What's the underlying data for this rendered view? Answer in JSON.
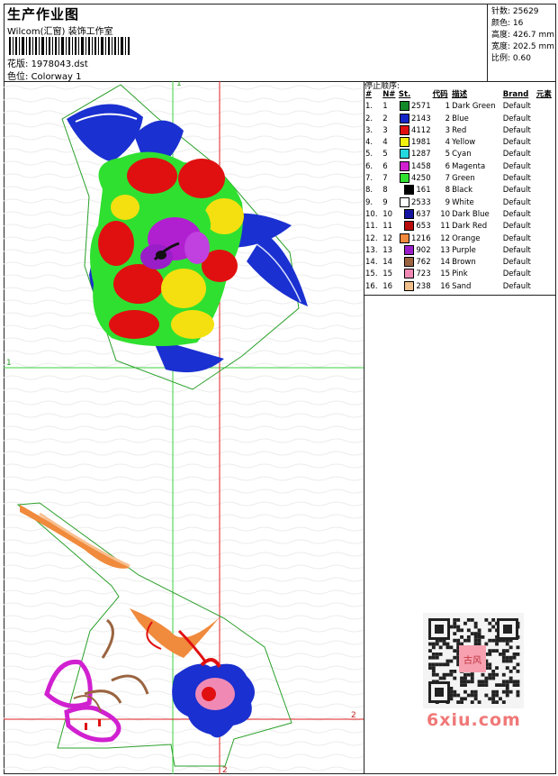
{
  "header": {
    "title": "生产作业图",
    "studio": "Wilcom(汇窗)  装饰工作室",
    "design_label": "花版:",
    "design_value": "1978043.dst",
    "colorway_label": "色位:",
    "colorway_value": "Colorway 1"
  },
  "stats": {
    "stitches": "针数: 25629",
    "colors": "颜色: 16",
    "height": "高度: 426.7 mm",
    "width": "宽度: 202.5 mm",
    "scale": "比例: 0.60"
  },
  "stop_sequence": {
    "title": "停止顺序:",
    "headers": [
      "#",
      "N#",
      "St.",
      "代码",
      "描述",
      "Brand",
      "元素"
    ],
    "rows": [
      {
        "n": "1.",
        "id": "1",
        "color": "#138a2a",
        "st": "2571",
        "code": "1",
        "desc": "Dark Green",
        "brand": "Default"
      },
      {
        "n": "2.",
        "id": "2",
        "color": "#1426c8",
        "st": "2143",
        "code": "2",
        "desc": "Blue",
        "brand": "Default"
      },
      {
        "n": "3.",
        "id": "3",
        "color": "#e01010",
        "st": "4112",
        "code": "3",
        "desc": "Red",
        "brand": "Default"
      },
      {
        "n": "4.",
        "id": "4",
        "color": "#f4f010",
        "st": "1981",
        "code": "4",
        "desc": "Yellow",
        "brand": "Default"
      },
      {
        "n": "5.",
        "id": "5",
        "color": "#24d8e0",
        "st": "1287",
        "code": "5",
        "desc": "Cyan",
        "brand": "Default"
      },
      {
        "n": "6.",
        "id": "6",
        "color": "#d020d0",
        "st": "1458",
        "code": "6",
        "desc": "Magenta",
        "brand": "Default"
      },
      {
        "n": "7.",
        "id": "7",
        "color": "#30e030",
        "st": "4250",
        "code": "7",
        "desc": "Green",
        "brand": "Default"
      },
      {
        "n": "8.",
        "id": "8",
        "color": "#000000",
        "st": "161",
        "code": "8",
        "desc": "Black",
        "brand": "Default"
      },
      {
        "n": "9.",
        "id": "9",
        "color": "#ffffff",
        "st": "2533",
        "code": "9",
        "desc": "White",
        "brand": "Default"
      },
      {
        "n": "10.",
        "id": "10",
        "color": "#1414a0",
        "st": "637",
        "code": "10",
        "desc": "Dark Blue",
        "brand": "Default"
      },
      {
        "n": "11.",
        "id": "11",
        "color": "#b80c0c",
        "st": "653",
        "code": "11",
        "desc": "Dark Red",
        "brand": "Default"
      },
      {
        "n": "12.",
        "id": "12",
        "color": "#f08a3c",
        "st": "1216",
        "code": "12",
        "desc": "Orange",
        "brand": "Default"
      },
      {
        "n": "13.",
        "id": "13",
        "color": "#9a1ec8",
        "st": "902",
        "code": "13",
        "desc": "Purple",
        "brand": "Default"
      },
      {
        "n": "14.",
        "id": "14",
        "color": "#9a6440",
        "st": "762",
        "code": "14",
        "desc": "Brown",
        "brand": "Default"
      },
      {
        "n": "15.",
        "id": "15",
        "color": "#f08ab4",
        "st": "723",
        "code": "15",
        "desc": "Pink",
        "brand": "Default"
      },
      {
        "n": "16.",
        "id": "16",
        "color": "#f0c08c",
        "st": "238",
        "code": "16",
        "desc": "Sand",
        "brand": "Default"
      }
    ]
  },
  "guides": {
    "label_1": "1",
    "label_2": "2"
  },
  "watermark": {
    "site": "6xiu.com",
    "seal": "古风"
  }
}
